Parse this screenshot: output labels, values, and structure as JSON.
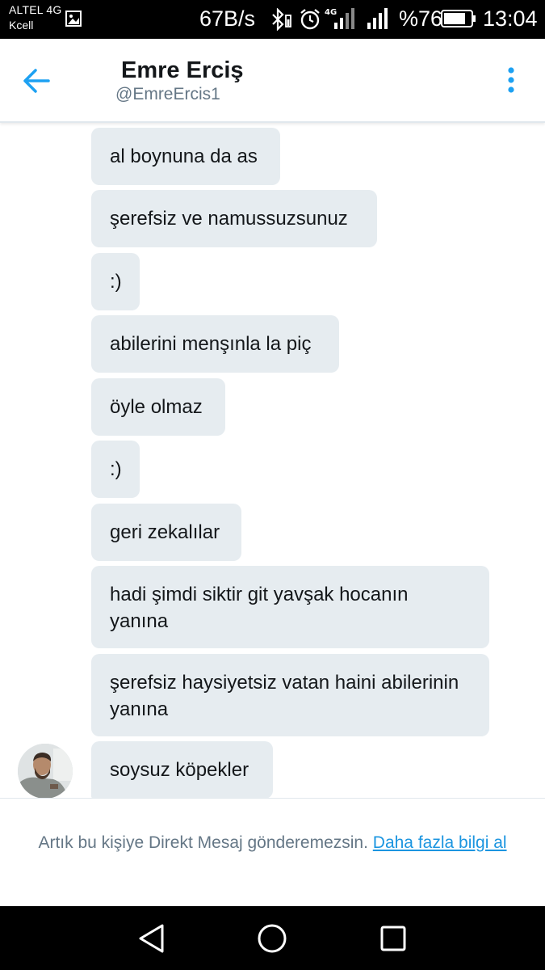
{
  "status_bar": {
    "carrier_1": "ALTEL 4G",
    "carrier_2": "Kcell",
    "net_speed": "67B/s",
    "network_type": "4G",
    "battery_percent": "%76",
    "time": "13:04"
  },
  "header": {
    "name": "Emre Erciş",
    "handle": "@EmreErcis1"
  },
  "messages": [
    {
      "text": "al boynuna da as"
    },
    {
      "text": "şerefsiz ve namussuzsunuz"
    },
    {
      "text": ":)"
    },
    {
      "text": "abilerini menşınla la piç"
    },
    {
      "text": "öyle olmaz"
    },
    {
      "text": ":)"
    },
    {
      "text": "geri zekalılar"
    },
    {
      "text": "hadi şimdi siktir git yavşak hocanın yanına"
    },
    {
      "text": "şerefsiz haysiyetsiz vatan haini abilerinin yanına"
    },
    {
      "text": "soysuz köpekler"
    }
  ],
  "footer": {
    "notice": "Artık bu kişiye Direkt Mesaj gönderemezsin.",
    "link": "Daha fazla bilgi al"
  },
  "colors": {
    "accent": "#1da1f2",
    "bubble": "#e6ecf0",
    "text_primary": "#14171a",
    "text_secondary": "#657786",
    "link": "#1b95e0"
  }
}
